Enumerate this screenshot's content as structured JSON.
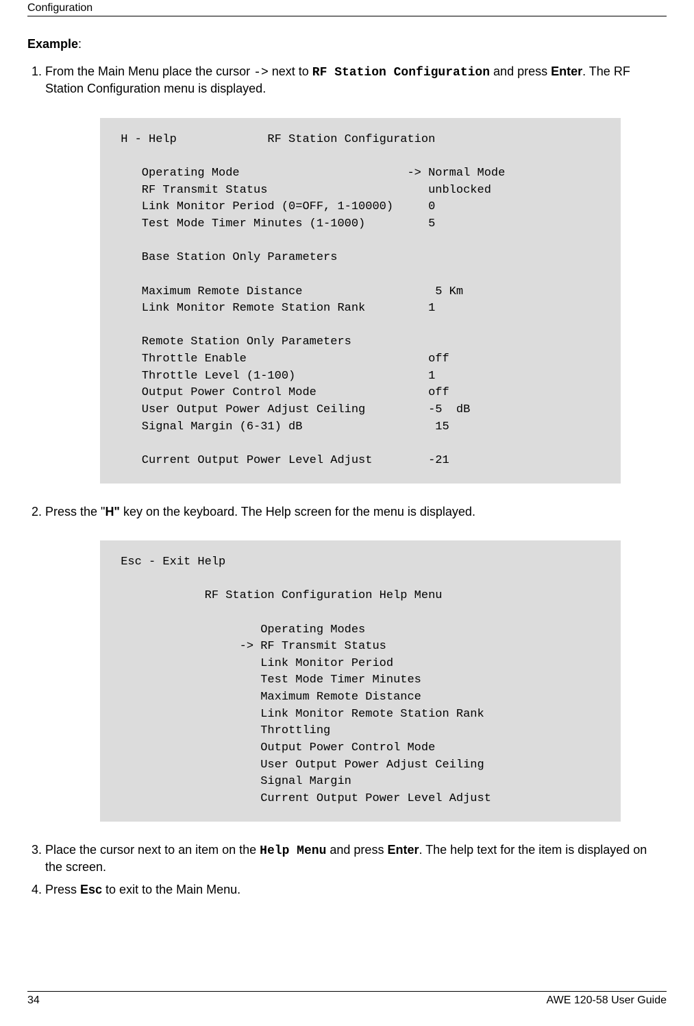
{
  "header": "Configuration",
  "exampleLabel": "Example",
  "step1": {
    "pre": "From the Main Menu place the cursor ",
    "arrow": "->",
    "mid": " next to ",
    "code": "RF Station Configuration",
    "mid2": " and press ",
    "bold": "Enter",
    "post": ". The RF Station Configuration menu is displayed."
  },
  "code1": " H - Help             RF Station Configuration\n\n    Operating Mode                        -> Normal Mode\n    RF Transmit Status                       unblocked\n    Link Monitor Period (0=OFF, 1-10000)     0\n    Test Mode Timer Minutes (1-1000)         5\n\n    Base Station Only Parameters\n\n    Maximum Remote Distance                   5 Km\n    Link Monitor Remote Station Rank         1\n\n    Remote Station Only Parameters\n    Throttle Enable                          off\n    Throttle Level (1-100)                   1\n    Output Power Control Mode                off\n    User Output Power Adjust Ceiling         -5  dB\n    Signal Margin (6-31) dB                   15\n\n    Current Output Power Level Adjust        -21",
  "step2": {
    "pre": "Press the \"",
    "bold": "H\"",
    "post": " key on the keyboard. The Help screen for the menu is displayed."
  },
  "code2": " Esc - Exit Help\n\n             RF Station Configuration Help Menu\n\n                     Operating Modes\n                  -> RF Transmit Status\n                     Link Monitor Period\n                     Test Mode Timer Minutes\n                     Maximum Remote Distance\n                     Link Monitor Remote Station Rank\n                     Throttling\n                     Output Power Control Mode\n                     User Output Power Adjust Ceiling\n                     Signal Margin\n                     Current Output Power Level Adjust",
  "step3": {
    "pre": "Place the cursor next to an item on the ",
    "code": "Help Menu",
    "mid": " and press ",
    "bold": "Enter",
    "post": ". The help text for the item is displayed on the screen."
  },
  "step4": {
    "pre": "Press ",
    "bold": "Esc",
    "post": " to exit to the Main Menu."
  },
  "footer": {
    "pageNumber": "34",
    "guide": "AWE 120-58 User Guide"
  }
}
